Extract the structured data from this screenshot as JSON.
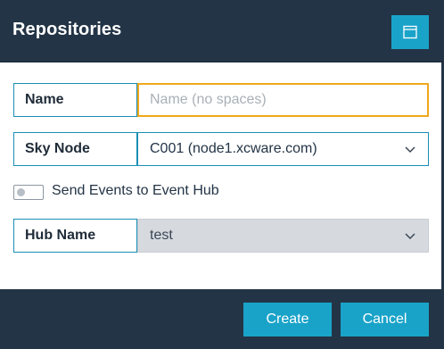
{
  "dialog": {
    "title": "Repositories",
    "maximize_icon": "window-maximize-icon"
  },
  "form": {
    "name": {
      "label": "Name",
      "value": "",
      "placeholder": "Name (no spaces)"
    },
    "sky_node": {
      "label": "Sky Node",
      "selected": "C001 (node1.xcware.com)",
      "icon": "chevron-down-icon"
    },
    "send_events": {
      "label": "Send Events to Event Hub",
      "checked": false
    },
    "hub_name": {
      "label": "Hub Name",
      "selected": "test",
      "disabled": true,
      "icon": "chevron-down-icon"
    }
  },
  "footer": {
    "create_label": "Create",
    "cancel_label": "Cancel"
  },
  "colors": {
    "header_bg": "#233446",
    "accent": "#1aa3c9",
    "focus_border": "#f0a81c",
    "field_border": "#1a8fb5",
    "disabled_bg": "#d6dadf"
  }
}
